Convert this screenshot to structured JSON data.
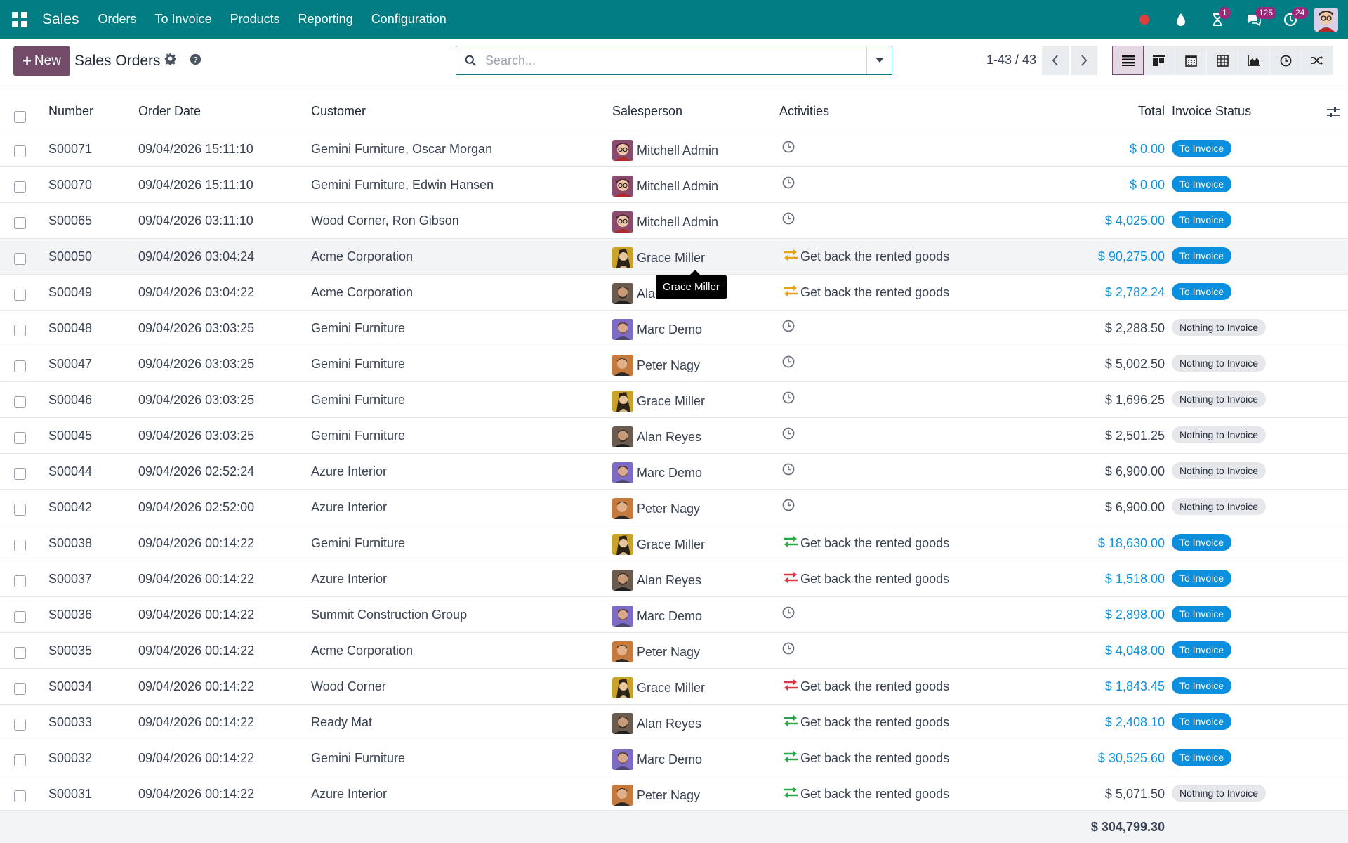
{
  "app": {
    "name": "Sales"
  },
  "nav": {
    "items": [
      "Orders",
      "To Invoice",
      "Products",
      "Reporting",
      "Configuration"
    ]
  },
  "systray": {
    "activity_badge": "1",
    "messages_badge": "125",
    "clock_badge": "24"
  },
  "control": {
    "new_label": "New",
    "title": "Sales Orders",
    "search_placeholder": "Search...",
    "pager": "1-43 / 43"
  },
  "columns": {
    "number": "Number",
    "order_date": "Order Date",
    "customer": "Customer",
    "salesperson": "Salesperson",
    "activities": "Activities",
    "total": "Total",
    "invoice_status": "Invoice Status"
  },
  "colors": {
    "brand": "#017e84",
    "primary": "#714b67",
    "link": "#0c8fdc",
    "green": "#28a745",
    "orange": "#e6a117",
    "red": "#dc3545"
  },
  "rows": [
    {
      "number": "S00071",
      "date": "09/04/2026 15:11:10",
      "customer": "Gemini Furniture, Oscar Morgan",
      "salesperson": "Mitchell Admin",
      "avatar": "mitchell",
      "activity": "",
      "activity_icon": "clock-icon",
      "total": "$ 0.00",
      "status": "To Invoice"
    },
    {
      "number": "S00070",
      "date": "09/04/2026 15:11:10",
      "customer": "Gemini Furniture, Edwin Hansen",
      "salesperson": "Mitchell Admin",
      "avatar": "mitchell",
      "activity": "",
      "activity_icon": "clock-icon",
      "total": "$ 0.00",
      "status": "To Invoice"
    },
    {
      "number": "S00065",
      "date": "09/04/2026 03:11:10",
      "customer": "Wood Corner, Ron Gibson",
      "salesperson": "Mitchell Admin",
      "avatar": "mitchell",
      "activity": "",
      "activity_icon": "clock-icon",
      "total": "$ 4,025.00",
      "status": "To Invoice"
    },
    {
      "number": "S00050",
      "date": "09/04/2026 03:04:24",
      "customer": "Acme Corporation",
      "salesperson": "Grace Miller",
      "avatar": "grace",
      "activity": "Get back the rented goods",
      "activity_icon": "exchange-orange-icon",
      "total": "$ 90,275.00",
      "status": "To Invoice"
    },
    {
      "number": "S00049",
      "date": "09/04/2026 03:04:22",
      "customer": "Acme Corporation",
      "salesperson": "Ala",
      "avatar": "alan",
      "activity": "Get back the rented goods",
      "activity_icon": "exchange-orange-icon",
      "total": "$ 2,782.24",
      "status": "To Invoice"
    },
    {
      "number": "S00048",
      "date": "09/04/2026 03:03:25",
      "customer": "Gemini Furniture",
      "salesperson": "Marc Demo",
      "avatar": "marc",
      "activity": "",
      "activity_icon": "clock-icon",
      "total": "$ 2,288.50",
      "status": "Nothing to Invoice"
    },
    {
      "number": "S00047",
      "date": "09/04/2026 03:03:25",
      "customer": "Gemini Furniture",
      "salesperson": "Peter Nagy",
      "avatar": "peter",
      "activity": "",
      "activity_icon": "clock-icon",
      "total": "$ 5,002.50",
      "status": "Nothing to Invoice"
    },
    {
      "number": "S00046",
      "date": "09/04/2026 03:03:25",
      "customer": "Gemini Furniture",
      "salesperson": "Grace Miller",
      "avatar": "grace",
      "activity": "",
      "activity_icon": "clock-icon",
      "total": "$ 1,696.25",
      "status": "Nothing to Invoice"
    },
    {
      "number": "S00045",
      "date": "09/04/2026 03:03:25",
      "customer": "Gemini Furniture",
      "salesperson": "Alan Reyes",
      "avatar": "alan",
      "activity": "",
      "activity_icon": "clock-icon",
      "total": "$ 2,501.25",
      "status": "Nothing to Invoice"
    },
    {
      "number": "S00044",
      "date": "09/04/2026 02:52:24",
      "customer": "Azure Interior",
      "salesperson": "Marc Demo",
      "avatar": "marc",
      "activity": "",
      "activity_icon": "clock-icon",
      "total": "$ 6,900.00",
      "status": "Nothing to Invoice"
    },
    {
      "number": "S00042",
      "date": "09/04/2026 02:52:00",
      "customer": "Azure Interior",
      "salesperson": "Peter Nagy",
      "avatar": "peter",
      "activity": "",
      "activity_icon": "clock-icon",
      "total": "$ 6,900.00",
      "status": "Nothing to Invoice"
    },
    {
      "number": "S00038",
      "date": "09/04/2026 00:14:22",
      "customer": "Gemini Furniture",
      "salesperson": "Grace Miller",
      "avatar": "grace",
      "activity": "Get back the rented goods",
      "activity_icon": "exchange-green-icon",
      "total": "$ 18,630.00",
      "status": "To Invoice"
    },
    {
      "number": "S00037",
      "date": "09/04/2026 00:14:22",
      "customer": "Azure Interior",
      "salesperson": "Alan Reyes",
      "avatar": "alan",
      "activity": "Get back the rented goods",
      "activity_icon": "exchange-red-icon",
      "total": "$ 1,518.00",
      "status": "To Invoice"
    },
    {
      "number": "S00036",
      "date": "09/04/2026 00:14:22",
      "customer": "Summit Construction Group",
      "salesperson": "Marc Demo",
      "avatar": "marc",
      "activity": "",
      "activity_icon": "clock-icon",
      "total": "$ 2,898.00",
      "status": "To Invoice"
    },
    {
      "number": "S00035",
      "date": "09/04/2026 00:14:22",
      "customer": "Acme Corporation",
      "salesperson": "Peter Nagy",
      "avatar": "peter",
      "activity": "",
      "activity_icon": "clock-icon",
      "total": "$ 4,048.00",
      "status": "To Invoice"
    },
    {
      "number": "S00034",
      "date": "09/04/2026 00:14:22",
      "customer": "Wood Corner",
      "salesperson": "Grace Miller",
      "avatar": "grace",
      "activity": "Get back the rented goods",
      "activity_icon": "exchange-red-icon",
      "total": "$ 1,843.45",
      "status": "To Invoice"
    },
    {
      "number": "S00033",
      "date": "09/04/2026 00:14:22",
      "customer": "Ready Mat",
      "salesperson": "Alan Reyes",
      "avatar": "alan",
      "activity": "Get back the rented goods",
      "activity_icon": "exchange-green-icon",
      "total": "$ 2,408.10",
      "status": "To Invoice"
    },
    {
      "number": "S00032",
      "date": "09/04/2026 00:14:22",
      "customer": "Gemini Furniture",
      "salesperson": "Marc Demo",
      "avatar": "marc",
      "activity": "Get back the rented goods",
      "activity_icon": "exchange-green-icon",
      "total": "$ 30,525.60",
      "status": "To Invoice"
    },
    {
      "number": "S00031",
      "date": "09/04/2026 00:14:22",
      "customer": "Azure Interior",
      "salesperson": "Peter Nagy",
      "avatar": "peter",
      "activity": "Get back the rented goods",
      "activity_icon": "exchange-green-icon",
      "total": "$ 5,071.50",
      "status": "Nothing to Invoice"
    }
  ],
  "footer": {
    "sum_total": "$ 304,799.30"
  },
  "tooltip": {
    "text": "Grace Miller"
  }
}
